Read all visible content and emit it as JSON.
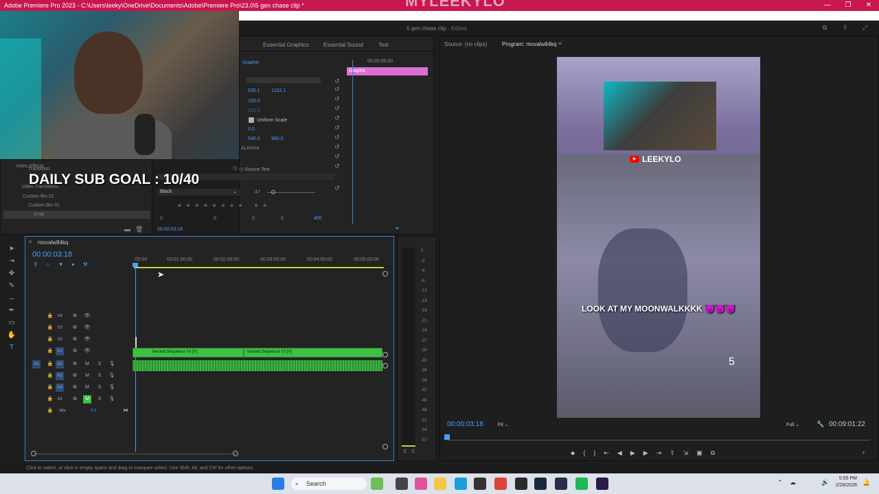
{
  "app": {
    "title": "Adobe Premiere Pro 2023 - C:\\Users\\leeky\\OneDrive\\Documents\\Adobe\\Premiere Pro\\23.0\\5 gen chase clip *",
    "overlay_brand": "MYLEEKYLO",
    "project_name": "5 gen chase clip",
    "edited": "- Edited"
  },
  "effects_tabs": [
    "Essential Graphics",
    "Essential Sound",
    "Text"
  ],
  "effect_controls": {
    "clip_label": "Graphic",
    "timecode_start": "00:00:05:00",
    "graphic_bar": "Graphic",
    "position": [
      "535.1",
      "1222.1"
    ],
    "scale": "100.0",
    "scale_width": "100.0",
    "uniform_scale": "Uniform Scale",
    "rotation": "0.0",
    "anchor": [
      "540.0",
      "960.0"
    ],
    "walk_text": "ALKKKK",
    "source_text": "Source Text",
    "font": "Black",
    "font_size": "47",
    "kerning": "0",
    "tracking": "0",
    "leading": "0",
    "baseline": "0",
    "tsume": "400",
    "current_time": "00:00:03:18"
  },
  "project_bin": {
    "items": [
      "Video Effects",
      "Transform",
      "Video Transitions",
      "Custom Bin 01",
      "Custom Bin 01",
      "Crop"
    ]
  },
  "webcam_overlay": {
    "sub_goal": "DAILY SUB GOAL : 10/40"
  },
  "timeline": {
    "sequence_name": "movalw84kq",
    "timecode": "00:00:03:18",
    "ruler": [
      ":00:00",
      "00:01:00:00",
      "00:02:00:00",
      "00:03:00:00",
      "00:04:00:00",
      "00:05:00:00"
    ],
    "video_tracks": [
      "V4",
      "V3",
      "V2",
      "V1"
    ],
    "audio_tracks": [
      "A1",
      "A2",
      "A3",
      "A4"
    ],
    "mix_label": "Mix",
    "mix_value": "0.0",
    "clips": [
      "Nested Sequence 03 [V]",
      "Nested Sequence 03 [V]"
    ],
    "meter_scale": [
      "0",
      "-3",
      "-6",
      "-9",
      "-12",
      "-15",
      "-18",
      "-21",
      "-24",
      "-27",
      "-30",
      "-33",
      "-36",
      "-39",
      "-42",
      "-45",
      "-48",
      "-51",
      "-54",
      "-57"
    ],
    "solo_labels": [
      "S",
      "S"
    ]
  },
  "monitor": {
    "source_tab": "Source: (no clips)",
    "program_tab": "Program: movalw84kq",
    "channel_name": "LEEKYLO",
    "caption": "LOOK AT MY MOONWALKKKK 😈😈😈",
    "corner_number": "5",
    "current_time": "00:00:03:18",
    "fit": "Fit",
    "quality": "Full",
    "duration": "00:09:01:22"
  },
  "status_bar": {
    "text": "Click to select, or click in empty space and drag to marquee select. Use Shift, Alt, and Ctrl for other options."
  },
  "taskbar": {
    "search": "Search",
    "time": "5:55 PM",
    "date": "2/28/2026"
  }
}
